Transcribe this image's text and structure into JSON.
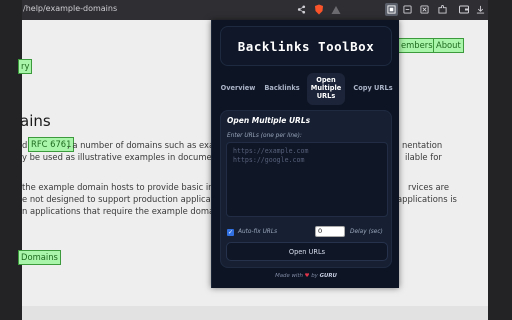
{
  "browser": {
    "url": "/help/example-domains"
  },
  "page": {
    "nav_links": [
      "embers",
      "About"
    ],
    "small_link": "ry",
    "heading": "ains",
    "para1": {
      "prefix": "d",
      "rfc_link": "RFC 6761",
      "line1_rest": ", a number of domains such as example",
      "line1_end": "nentation",
      "line2": "y be used as illustrative examples in documents wi",
      "line2_end": "ilable for"
    },
    "para2": {
      "line1": "the example domain hosts to provide basic informa",
      "line1_end": "rvices are",
      "line2": "e not designed to support production applications",
      "line2_end": "applications is",
      "line3": "n applications that require the example domains t"
    },
    "domains_link": "Domains"
  },
  "extension": {
    "title": "Backlinks ToolBox",
    "tabs": [
      {
        "label": "Overview"
      },
      {
        "label": "Backlinks"
      },
      {
        "label": "Open\nMultiple\nURLs"
      },
      {
        "label": "Copy URLs"
      }
    ],
    "panel": {
      "title": "Open Multiple URLs",
      "label": "Enter URLs (one per line):",
      "placeholder": "https://example.com\nhttps://google.com",
      "autofix_label": "Auto-fix URLs",
      "autofix_checked": true,
      "delay_value": "0",
      "delay_label": "Delay (sec)",
      "open_button": "Open URLs"
    },
    "footer": {
      "made_with": "Made with",
      "by": "by",
      "brand": "GURU"
    }
  }
}
